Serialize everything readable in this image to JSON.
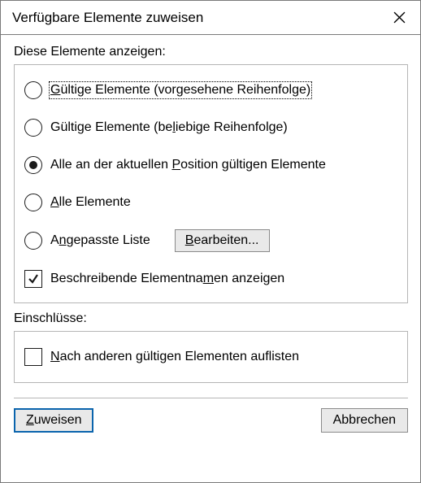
{
  "title": "Verfügbare Elemente zuweisen",
  "section_display": "Diese Elemente anzeigen:",
  "options": [
    {
      "pre": "",
      "key": "G",
      "post": "ültige Elemente (vorgesehene Reihenfolge)",
      "selected": false,
      "focused": true
    },
    {
      "pre": "Gültige Elemente (be",
      "key": "l",
      "post": "iebige Reihenfolge)",
      "selected": false,
      "focused": false
    },
    {
      "pre": "Alle an der aktuellen ",
      "key": "P",
      "post": "osition gültigen Elemente",
      "selected": true,
      "focused": false
    },
    {
      "pre": "",
      "key": "A",
      "post": "lle Elemente",
      "selected": false,
      "focused": false
    },
    {
      "pre": "A",
      "key": "n",
      "post": "gepasste Liste",
      "selected": false,
      "focused": false
    }
  ],
  "edit_button": {
    "pre": "",
    "key": "B",
    "post": "earbeiten..."
  },
  "checkbox_descriptive": {
    "pre": "Beschreibende Elementna",
    "key": "m",
    "post": "en anzeigen",
    "checked": true
  },
  "section_includes": "Einschlüsse:",
  "checkbox_after": {
    "pre": "",
    "key": "N",
    "post": "ach anderen gültigen Elementen auflisten",
    "checked": false
  },
  "btn_assign": {
    "pre": "",
    "key": "Z",
    "post": "uweisen"
  },
  "btn_cancel": "Abbrechen"
}
